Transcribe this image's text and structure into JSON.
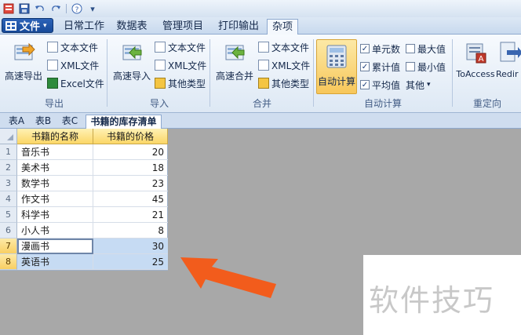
{
  "file_menu": {
    "label": "文件"
  },
  "tabs": [
    "日常工作",
    "数据表",
    "管理项目",
    "打印输出",
    "杂项"
  ],
  "ribbon": {
    "export": {
      "big": "高速导出",
      "items": [
        "文本文件",
        "XML文件",
        "Excel文件"
      ],
      "label": "导出"
    },
    "import": {
      "big": "高速导入",
      "items": [
        "文本文件",
        "XML文件",
        "其他类型"
      ],
      "label": "导入"
    },
    "merge": {
      "big": "高速合并",
      "items": [
        "文本文件",
        "XML文件",
        "其他类型"
      ],
      "label": "合并"
    },
    "autocalc": {
      "big": "自动计算",
      "checks": [
        "单元数",
        "累计值",
        "平均值"
      ],
      "checks2": [
        "最大值",
        "最小值"
      ],
      "other": "其他",
      "label": "自动计算"
    },
    "redirect": {
      "items": [
        "ToAccess",
        "Redir"
      ],
      "label": "重定向"
    }
  },
  "sheet_tabs": [
    "表A",
    "表B",
    "表C",
    "书籍的库存清单"
  ],
  "table": {
    "headers": [
      "书籍的名称",
      "书籍的价格"
    ],
    "rows": [
      {
        "n": "1",
        "name": "音乐书",
        "price": "20"
      },
      {
        "n": "2",
        "name": "美术书",
        "price": "18"
      },
      {
        "n": "3",
        "name": "数学书",
        "price": "23"
      },
      {
        "n": "4",
        "name": "作文书",
        "price": "45"
      },
      {
        "n": "5",
        "name": "科学书",
        "price": "21"
      },
      {
        "n": "6",
        "name": "小人书",
        "price": "8"
      },
      {
        "n": "7",
        "name": "漫画书",
        "price": "30"
      },
      {
        "n": "8",
        "name": "英语书",
        "price": "25"
      }
    ]
  },
  "watermark": "软件技巧",
  "colors": {
    "accent": "#f25c1c",
    "selection": "#c6dbf3",
    "header": "#fbd767"
  }
}
